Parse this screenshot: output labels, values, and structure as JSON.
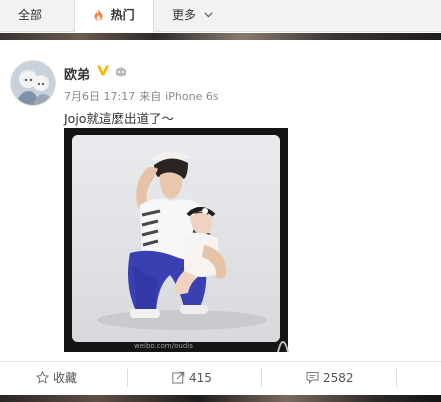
{
  "tabs": [
    {
      "label": "全部"
    },
    {
      "label": "热门"
    },
    {
      "label": "更多"
    }
  ],
  "post": {
    "username": "欧弟",
    "date": "7月6日 17:17",
    "source_prefix": "来自",
    "source": "iPhone 6s",
    "text": "Jojo就這麼出道了～",
    "watermark": "weibo.com/oudis"
  },
  "actions": {
    "favorite_label": "收藏",
    "repost_count": "415",
    "comment_count": "2582"
  },
  "colors": {
    "accent_orange": "#ff8140",
    "verified_gold": "#f5b800"
  },
  "icons": {
    "hot": "flame-icon",
    "more": "chevron-down-icon",
    "verified": "verified-v-icon",
    "member": "member-icon",
    "favorite": "star-icon",
    "repost": "repost-icon",
    "comment": "comment-icon"
  }
}
